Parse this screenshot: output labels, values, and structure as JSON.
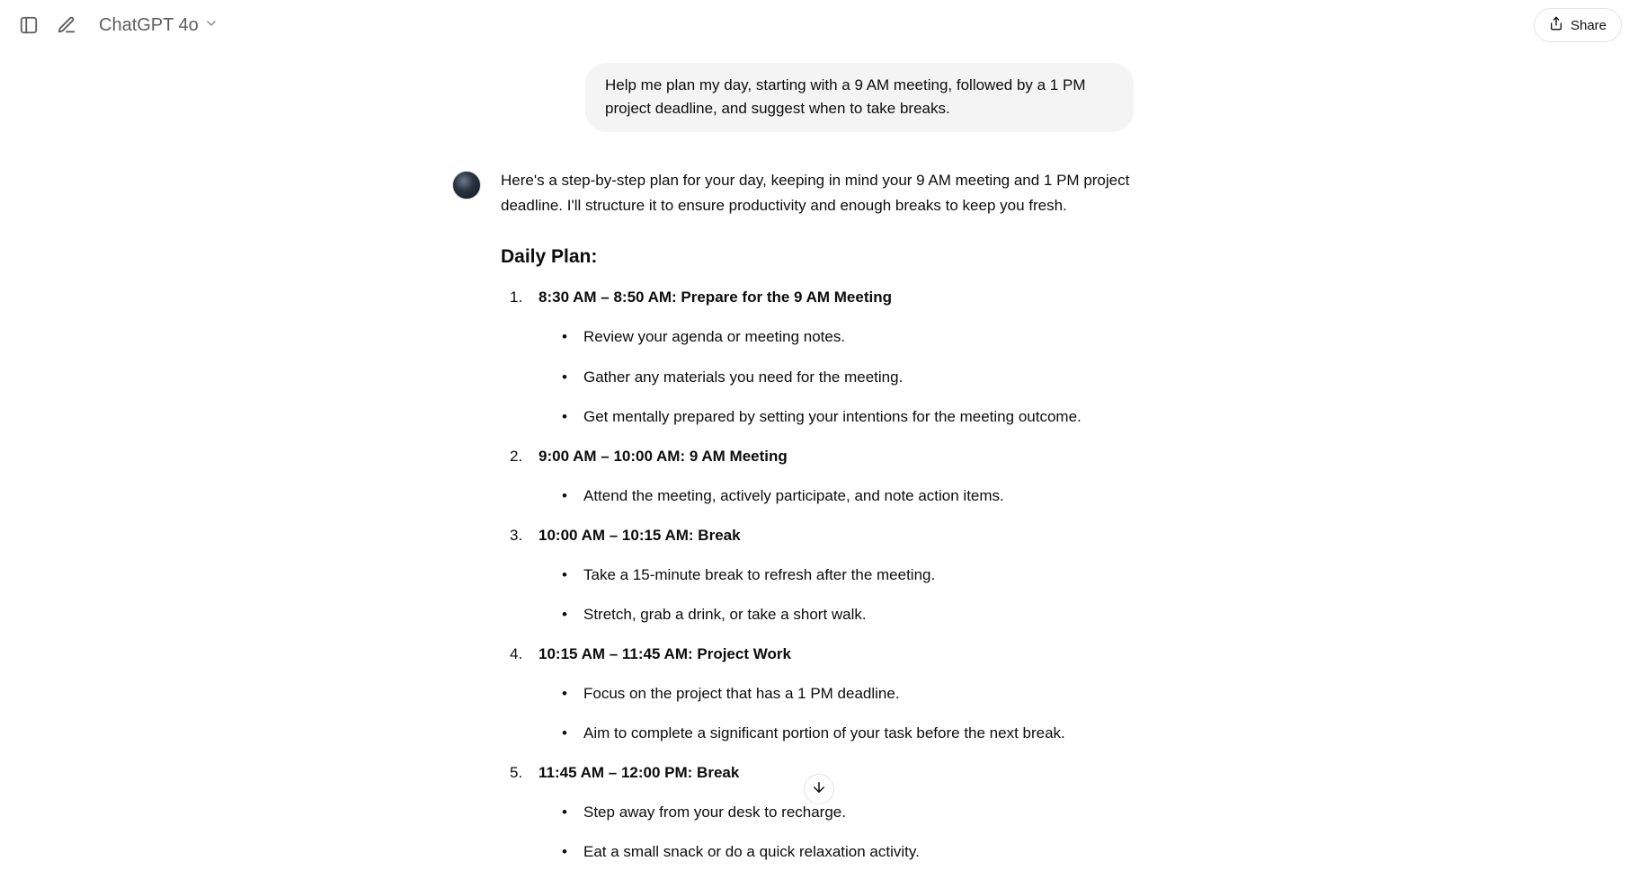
{
  "header": {
    "model_name": "ChatGPT 4o",
    "share_label": "Share"
  },
  "conversation": {
    "user_message": "Help me plan my day, starting with a 9 AM meeting, followed by a 1 PM project deadline, and suggest when to take breaks.",
    "assistant_intro": "Here's a step-by-step plan for your day, keeping in mind your 9 AM meeting and 1 PM project deadline. I'll structure it to ensure productivity and enough breaks to keep you fresh.",
    "plan_heading": "Daily Plan:",
    "plan": [
      {
        "title": "8:30 AM – 8:50 AM: Prepare for the 9 AM Meeting",
        "items": [
          "Review your agenda or meeting notes.",
          "Gather any materials you need for the meeting.",
          "Get mentally prepared by setting your intentions for the meeting outcome."
        ]
      },
      {
        "title": "9:00 AM – 10:00 AM: 9 AM Meeting",
        "items": [
          "Attend the meeting, actively participate, and note action items."
        ]
      },
      {
        "title": "10:00 AM – 10:15 AM: Break",
        "items": [
          "Take a 15-minute break to refresh after the meeting.",
          "Stretch, grab a drink, or take a short walk."
        ]
      },
      {
        "title": "10:15 AM – 11:45 AM: Project Work",
        "items": [
          "Focus on the project that has a 1 PM deadline.",
          "Aim to complete a significant portion of your task before the next break."
        ]
      },
      {
        "title": "11:45 AM – 12:00 PM: Break",
        "items": [
          "Step away from your desk to recharge.",
          "Eat a small snack or do a quick relaxation activity."
        ]
      }
    ]
  }
}
